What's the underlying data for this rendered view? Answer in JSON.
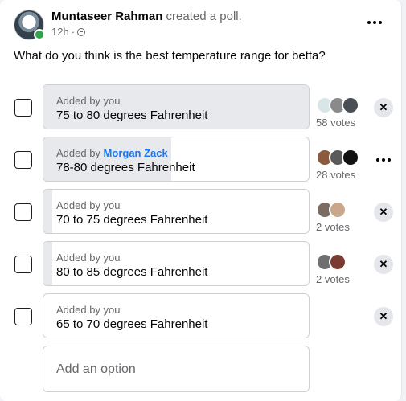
{
  "post": {
    "author": "Muntaseer Rahman",
    "action": "created a poll.",
    "time": "12h",
    "separator": "·",
    "privacy_icon": "globe-icon",
    "question": "What do you think is the best temperature range for betta?"
  },
  "options": [
    {
      "added_prefix": "Added by you",
      "added_by_user": "",
      "label": "75 to 80 degrees Fahrenheit",
      "votes": "58 votes",
      "vote_share": 1.0,
      "action": "remove",
      "remove_glyph": "✕",
      "voter_avatar_colors": [
        "#d8e6e8",
        "#8a8a8a",
        "#4a4f55"
      ]
    },
    {
      "added_prefix": "Added by ",
      "added_by_user": "Morgan Zack",
      "label": "78-80 degrees Fahrenheit",
      "votes": "28 votes",
      "vote_share": 0.48,
      "action": "more",
      "remove_glyph": "",
      "voter_avatar_colors": [
        "#8b5a3c",
        "#5a5a5a",
        "#111111"
      ]
    },
    {
      "added_prefix": "Added by you",
      "added_by_user": "",
      "label": "70 to 75 degrees Fahrenheit",
      "votes": "2 votes",
      "vote_share": 0.034,
      "action": "remove",
      "remove_glyph": "✕",
      "voter_avatar_colors": [
        "#7c6b62",
        "#c9a78a"
      ]
    },
    {
      "added_prefix": "Added by you",
      "added_by_user": "",
      "label": "80 to 85 degrees Fahrenheit",
      "votes": "2 votes",
      "vote_share": 0.034,
      "action": "remove",
      "remove_glyph": "✕",
      "voter_avatar_colors": [
        "#6f6f6f",
        "#7a3c32"
      ]
    },
    {
      "added_prefix": "Added by you",
      "added_by_user": "",
      "label": "65 to 70 degrees Fahrenheit",
      "votes": "",
      "vote_share": 0,
      "action": "remove",
      "remove_glyph": "✕",
      "voter_avatar_colors": []
    }
  ],
  "add_option": {
    "placeholder": "Add an option",
    "value": ""
  },
  "colors": {
    "link": "#1877f2",
    "vote_fill": "#e8e9ec",
    "online": "#31a24c"
  }
}
